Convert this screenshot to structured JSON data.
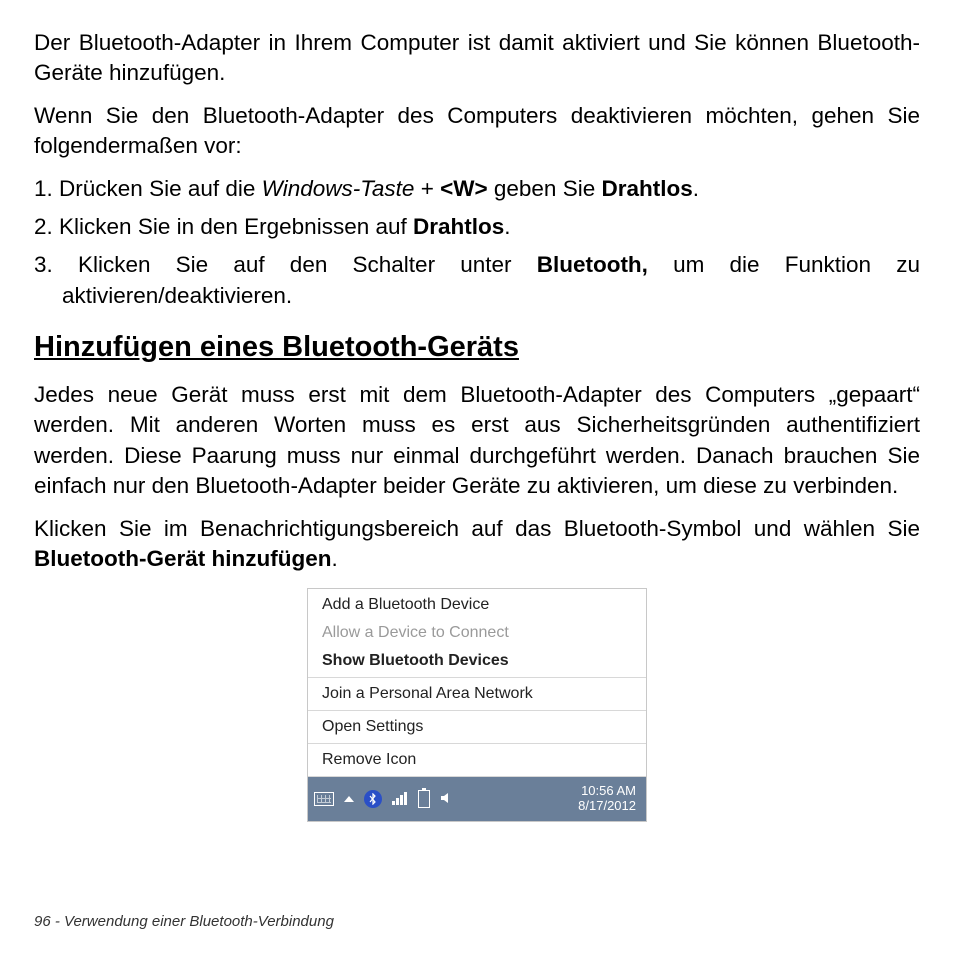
{
  "p1": "Der Bluetooth-Adapter in Ihrem Computer ist damit aktiviert und Sie können Bluetooth-Geräte hinzufügen.",
  "p2": "Wenn Sie den Bluetooth-Adapter des Computers deaktivieren möchten, gehen Sie folgendermaßen vor:",
  "step1": {
    "num": "1. ",
    "a": "Drücken Sie auf die ",
    "b": "Windows-Taste",
    "c": " + ",
    "d": "<W>",
    "e": " geben Sie ",
    "f": "Drahtlos",
    "g": "."
  },
  "step2": {
    "num": "2. ",
    "a": "Klicken Sie in den Ergebnissen auf ",
    "b": "Drahtlos",
    "c": "."
  },
  "step3": {
    "num": "3. ",
    "a": "Klicken Sie auf den Schalter unter ",
    "b": "Bluetooth,",
    "c": " um die Funktion zu aktivieren/deaktivieren."
  },
  "h2": "Hinzufügen eines Bluetooth-Geräts",
  "p3": "Jedes neue Gerät muss erst mit dem Bluetooth-Adapter des Computers „gepaart“ werden. Mit anderen Worten muss es erst aus Sicherheitsgründen authentifiziert werden. Diese Paarung muss nur einmal durchgeführt werden. Danach brauchen Sie einfach nur den Bluetooth-Adapter beider Geräte zu aktivieren, um diese zu verbinden.",
  "p4a": "Klicken Sie im Benachrichtigungsbereich auf das Bluetooth-Symbol und wählen Sie ",
  "p4b": "Bluetooth-Gerät hinzufügen",
  "p4c": ".",
  "menu": {
    "add": "Add a Bluetooth Device",
    "allow": "Allow a Device to Connect",
    "show": "Show Bluetooth Devices",
    "join": "Join a Personal Area Network",
    "open": "Open Settings",
    "remove": "Remove Icon"
  },
  "tray": {
    "bt_glyph": "⁕",
    "time": "10:56 AM",
    "date": "8/17/2012"
  },
  "footer": "96 - Verwendung einer Bluetooth-Verbindung"
}
